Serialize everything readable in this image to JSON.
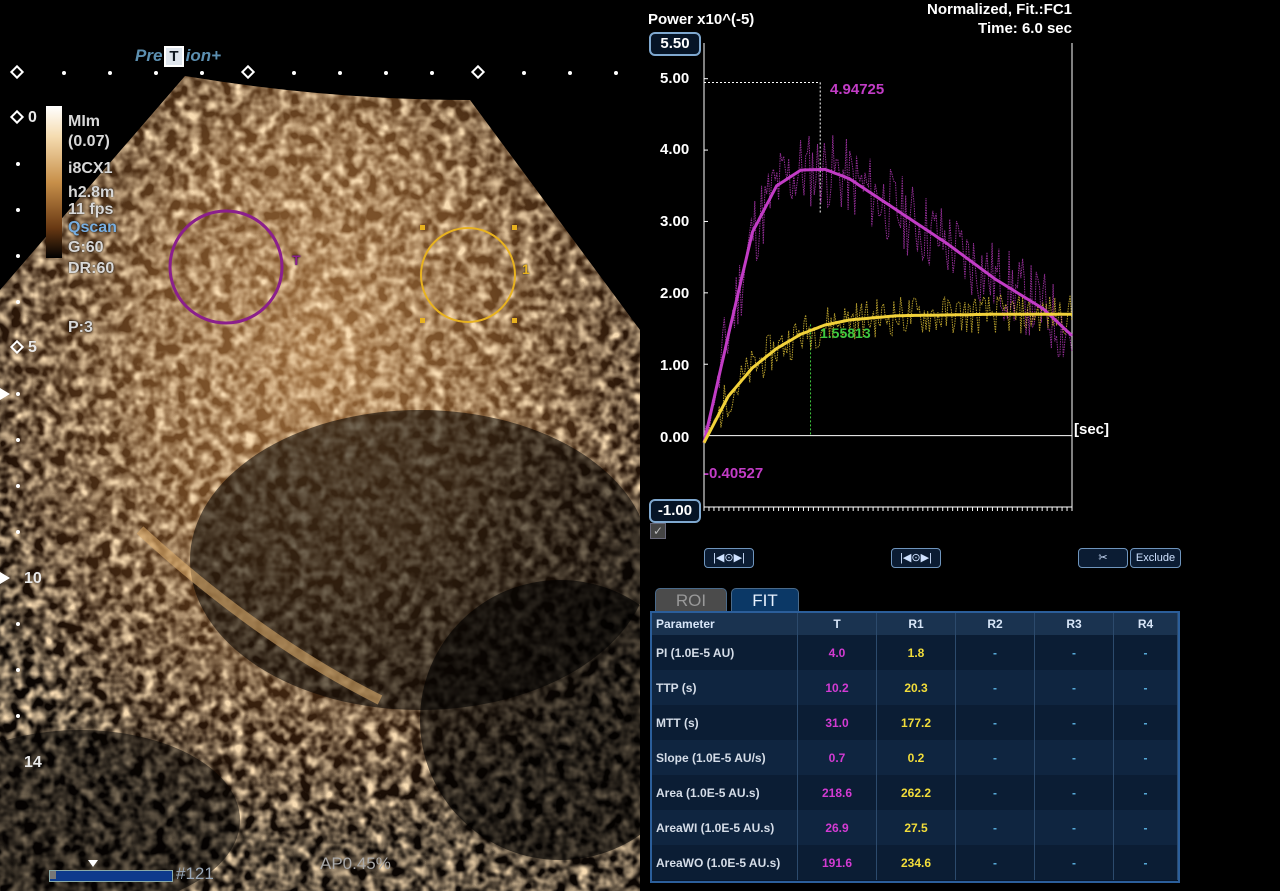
{
  "brand": {
    "pre": "Pre",
    "mid": "T",
    "post": "ion+"
  },
  "settings": [
    "MIm",
    "(0.07)",
    "i8CX1",
    "h2.8m",
    "11 fps",
    "Qscan",
    "G:60",
    "DR:60",
    "P:3"
  ],
  "depth_marks": [
    "0",
    "5",
    "10",
    "14"
  ],
  "roi_labels": {
    "t": "T",
    "r1": "1"
  },
  "frame": "#121",
  "acoustic_power": "AP0.45%",
  "chart_header": {
    "power": "Power x10^(-5)",
    "normalized": "Normalized, Fit.:FC1",
    "time": "Time: 6.0 sec"
  },
  "chart_data": {
    "type": "line",
    "ylabel": "Power x10^(-5)",
    "xlabel": "[sec]",
    "ylim": [
      -1.0,
      5.5
    ],
    "yticks": [
      "5.00",
      "4.00",
      "3.00",
      "2.00",
      "1.00",
      "0.00"
    ],
    "pill_top": "5.50",
    "pill_bottom": "-1.00",
    "annotations": {
      "peak": "4.94725",
      "mid": "1.55813",
      "min": "-0.40527"
    },
    "series": [
      {
        "name": "T",
        "color": "#c23cc6",
        "fit": [
          [
            0,
            -0.1
          ],
          [
            5,
            1.4
          ],
          [
            10,
            2.85
          ],
          [
            15,
            3.5
          ],
          [
            20,
            3.72
          ],
          [
            25,
            3.73
          ],
          [
            30,
            3.6
          ],
          [
            40,
            3.15
          ],
          [
            50,
            2.7
          ],
          [
            60,
            2.2
          ],
          [
            70,
            1.78
          ],
          [
            76,
            1.4
          ]
        ]
      },
      {
        "name": "R1",
        "color": "#f2d23a",
        "fit": [
          [
            0,
            -0.1
          ],
          [
            5,
            0.55
          ],
          [
            10,
            0.95
          ],
          [
            15,
            1.22
          ],
          [
            20,
            1.42
          ],
          [
            25,
            1.55
          ],
          [
            30,
            1.62
          ],
          [
            40,
            1.68
          ],
          [
            50,
            1.69
          ],
          [
            60,
            1.7
          ],
          [
            76,
            1.7
          ]
        ]
      }
    ]
  },
  "buttons": {
    "b1": "|◀⊙▶|",
    "b2": "|◀⊙▶|",
    "exclude": "Exclude"
  },
  "tabs": {
    "roi": "ROI",
    "fit": "FIT"
  },
  "table": {
    "headers": [
      "Parameter",
      "T",
      "R1",
      "R2",
      "R3",
      "R4"
    ],
    "rows": [
      [
        "PI (1.0E-5 AU)",
        "4.0",
        "1.8",
        "-",
        "-",
        "-"
      ],
      [
        "TTP (s)",
        "10.2",
        "20.3",
        "-",
        "-",
        "-"
      ],
      [
        "MTT (s)",
        "31.0",
        "177.2",
        "-",
        "-",
        "-"
      ],
      [
        "Slope (1.0E-5 AU/s)",
        "0.7",
        "0.2",
        "-",
        "-",
        "-"
      ],
      [
        "Area (1.0E-5 AU.s)",
        "218.6",
        "262.2",
        "-",
        "-",
        "-"
      ],
      [
        "AreaWI (1.0E-5 AU.s)",
        "26.9",
        "27.5",
        "-",
        "-",
        "-"
      ],
      [
        "AreaWO (1.0E-5 AU.s)",
        "191.6",
        "234.6",
        "-",
        "-",
        "-"
      ]
    ]
  }
}
